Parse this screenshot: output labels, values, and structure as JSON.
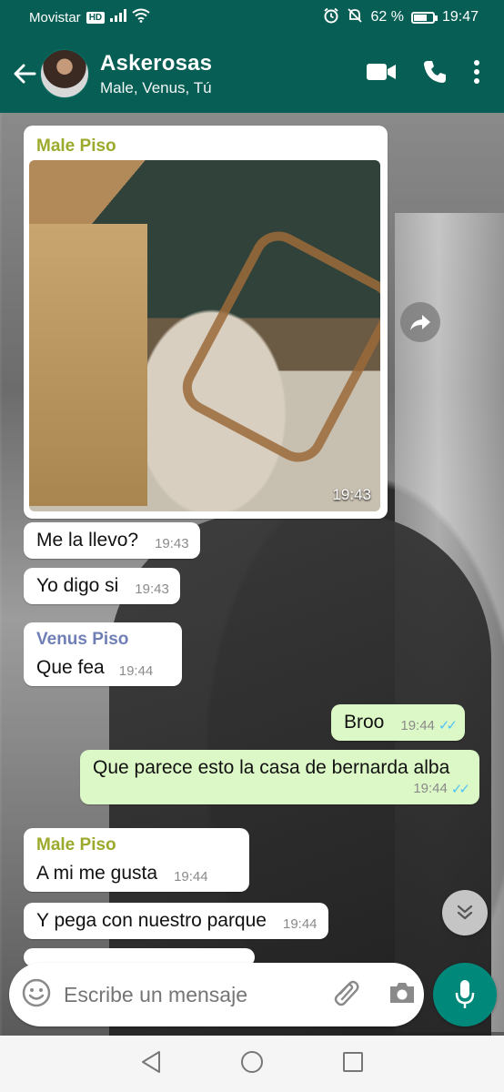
{
  "status_bar": {
    "carrier": "Movistar",
    "carrier_badge": "HD",
    "battery_percent": "62 %",
    "battery_level": 0.62,
    "time": "19:47"
  },
  "header": {
    "title": "Askerosas",
    "subtitle": "Male, Venus, Tú",
    "brand_color": "#075e54"
  },
  "messages": [
    {
      "type": "image",
      "sender": "Male Piso",
      "sender_color": "#9caa2c",
      "time": "19:43"
    },
    {
      "text": "Me la llevo?",
      "time": "19:43",
      "direction": "in"
    },
    {
      "text": "Yo digo si",
      "time": "19:43",
      "direction": "in"
    },
    {
      "sender": "Venus Piso",
      "sender_color": "#6f7fb6",
      "text": "Que fea",
      "time": "19:44",
      "direction": "in"
    },
    {
      "text": "Broo",
      "time": "19:44",
      "direction": "out",
      "read": true
    },
    {
      "text": "Que parece esto la casa de bernarda alba",
      "time": "19:44",
      "direction": "out",
      "read": true
    },
    {
      "sender": "Male Piso",
      "sender_color": "#9caa2c",
      "text": "A mi me gusta",
      "time": "19:44",
      "direction": "in"
    },
    {
      "text": "Y pega con nuestro parque",
      "time": "19:44",
      "direction": "in"
    }
  ],
  "composer": {
    "placeholder": "Escribe un mensaje"
  },
  "colors": {
    "outgoing_bubble": "#dcf8c6",
    "incoming_bubble": "#ffffff",
    "read_ticks": "#4fc3f7",
    "mic_button": "#00897b"
  }
}
